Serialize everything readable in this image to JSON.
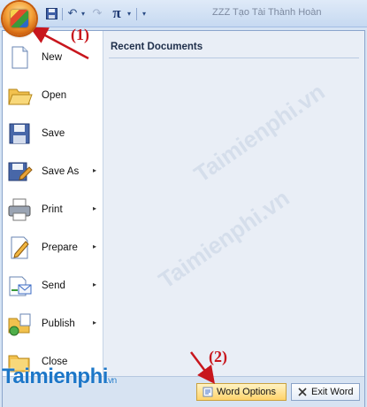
{
  "app": {
    "title_text": "ZZZ Tạo Tài Thành Hoàn",
    "qat": {
      "undo_symbol": "↶",
      "redo_symbol": "↷",
      "pi_symbol": "π",
      "dropdown_symbol": "▾"
    }
  },
  "menu": {
    "commands": [
      {
        "label": "New",
        "icon": "new-document-icon",
        "submenu": false
      },
      {
        "label": "Open",
        "icon": "folder-open-icon",
        "submenu": false
      },
      {
        "label": "Save",
        "icon": "floppy-disk-icon",
        "submenu": false
      },
      {
        "label": "Save As",
        "icon": "save-as-icon",
        "submenu": true
      },
      {
        "label": "Print",
        "icon": "printer-icon",
        "submenu": true
      },
      {
        "label": "Prepare",
        "icon": "prepare-icon",
        "submenu": true
      },
      {
        "label": "Send",
        "icon": "send-icon",
        "submenu": true
      },
      {
        "label": "Publish",
        "icon": "publish-icon",
        "submenu": true
      },
      {
        "label": "Close",
        "icon": "folder-close-icon",
        "submenu": false
      }
    ],
    "submenu_arrow": "▸",
    "recent_title": "Recent Documents",
    "footer": {
      "word_options_label": "Word Options",
      "exit_word_label": "Exit Word"
    }
  },
  "annotations": {
    "step1": "(1)",
    "step2": "(2)"
  },
  "watermark": {
    "brand": "Taimienphi",
    "suffix": ".vn"
  },
  "colors": {
    "annotation": "#c8161d",
    "office_orb": "#f6a43b",
    "watermark": "#1d77c8"
  }
}
